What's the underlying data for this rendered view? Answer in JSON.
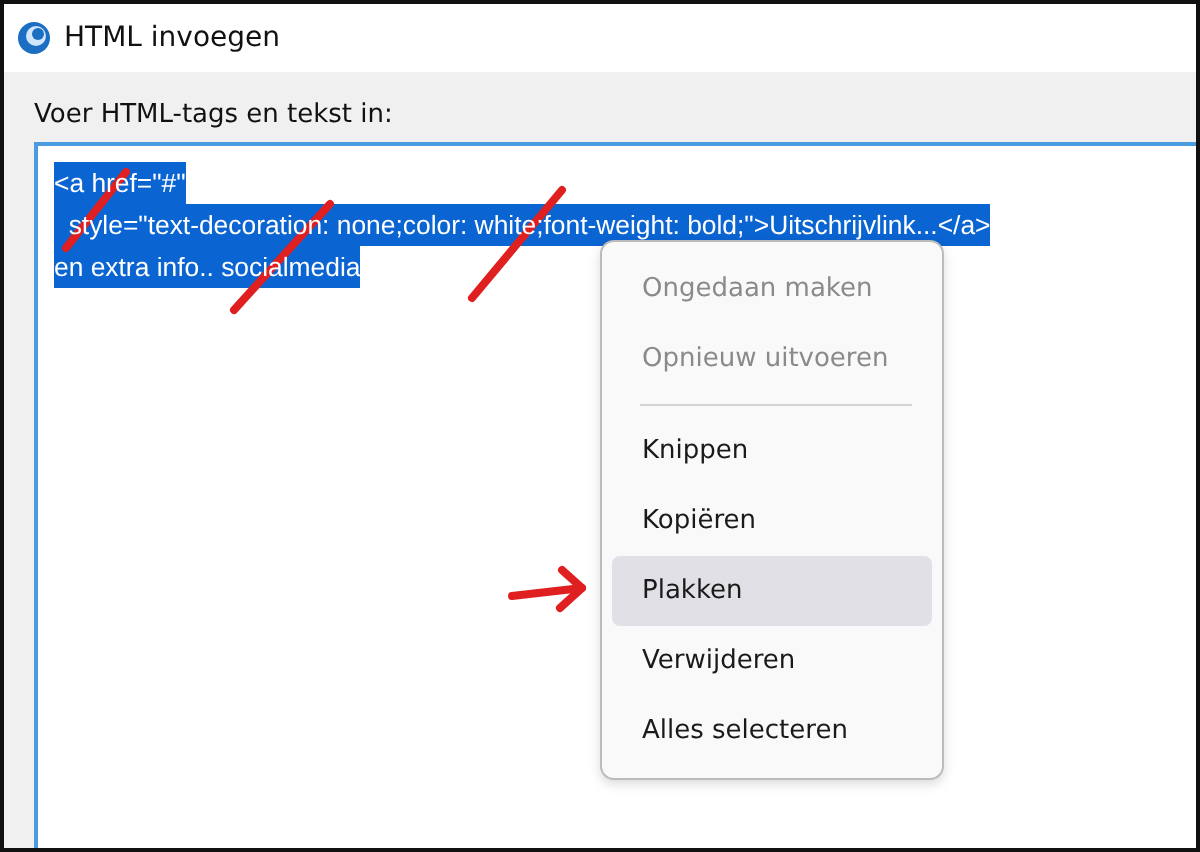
{
  "window": {
    "title": "HTML invoegen"
  },
  "prompt": "Voer HTML-tags en tekst in:",
  "editor": {
    "lines": [
      {
        "text": "<a href=\"#\"",
        "selected": true
      },
      {
        "text": "  style=\"text-decoration: none;color: white;font-weight: bold;\">Uitschrijvlink...</a>",
        "selected": true
      },
      {
        "text": "en extra info.. socialmedia",
        "selected": true
      }
    ]
  },
  "context_menu": {
    "items": [
      {
        "kind": "item",
        "label": "Ongedaan maken",
        "disabled": true,
        "selected": false
      },
      {
        "kind": "item",
        "label": "Opnieuw uitvoeren",
        "disabled": true,
        "selected": false
      },
      {
        "kind": "separator"
      },
      {
        "kind": "item",
        "label": "Knippen",
        "disabled": false,
        "selected": false
      },
      {
        "kind": "item",
        "label": "Kopiëren",
        "disabled": false,
        "selected": false
      },
      {
        "kind": "item",
        "label": "Plakken",
        "disabled": false,
        "selected": true
      },
      {
        "kind": "item",
        "label": "Verwijderen",
        "disabled": false,
        "selected": false
      },
      {
        "kind": "item",
        "label": "Alles selecteren",
        "disabled": false,
        "selected": false
      }
    ]
  }
}
